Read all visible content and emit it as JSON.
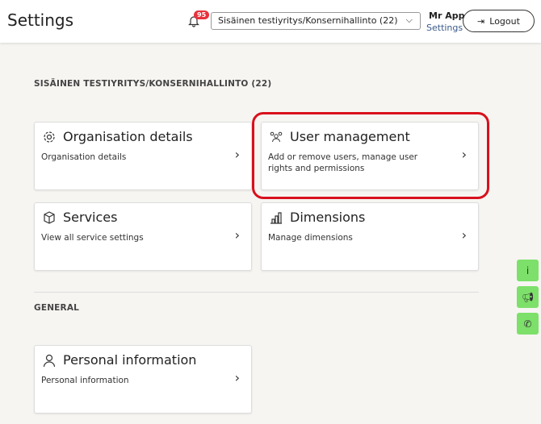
{
  "header": {
    "title": "Settings",
    "notification_count": "95",
    "org_select": "Sisäinen testiyritys/Konsernihallinto (22)",
    "user_name": "Mr App",
    "user_settings": "Settings",
    "logout": "Logout"
  },
  "sections": {
    "org": "SISÄINEN TESTIYRITYS/KONSERNIHALLINTO (22)",
    "general": "GENERAL"
  },
  "cards": [
    {
      "title": "Organisation details",
      "desc": "Organisation details",
      "icon": "gear-icon"
    },
    {
      "title": "User management",
      "desc": "Add or remove users, manage user rights and permissions",
      "icon": "users-icon"
    },
    {
      "title": "Services",
      "desc": "View all service settings",
      "icon": "box-icon"
    },
    {
      "title": "Dimensions",
      "desc": "Manage dimensions",
      "icon": "bar-chart-icon"
    },
    {
      "title": "Personal information",
      "desc": "Personal information",
      "icon": "person-icon"
    }
  ],
  "side_buttons": {
    "info": "i"
  },
  "colors": {
    "highlight": "#d9101c",
    "side": "#7de06a",
    "badge": "#e8323c"
  }
}
